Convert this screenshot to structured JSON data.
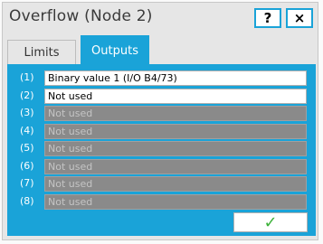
{
  "dialog": {
    "title": "Overflow (Node 2)",
    "help_label": "?",
    "close_label": "×"
  },
  "tabs": [
    {
      "label": "Limits",
      "active": false
    },
    {
      "label": "Outputs",
      "active": true
    }
  ],
  "outputs": [
    {
      "index": "(1)",
      "value": "Binary value 1 (I/O B4/73)",
      "enabled": true
    },
    {
      "index": "(2)",
      "value": "Not used",
      "enabled": true
    },
    {
      "index": "(3)",
      "value": "Not used",
      "enabled": false
    },
    {
      "index": "(4)",
      "value": "Not used",
      "enabled": false
    },
    {
      "index": "(5)",
      "value": "Not used",
      "enabled": false
    },
    {
      "index": "(6)",
      "value": "Not used",
      "enabled": false
    },
    {
      "index": "(7)",
      "value": "Not used",
      "enabled": false
    },
    {
      "index": "(8)",
      "value": "Not used",
      "enabled": false
    }
  ],
  "ok_button": {
    "label": "✓"
  },
  "colors": {
    "accent": "#1aa3d8",
    "ok_check": "#3db23a",
    "disabled_field": "#8a8a8a"
  }
}
